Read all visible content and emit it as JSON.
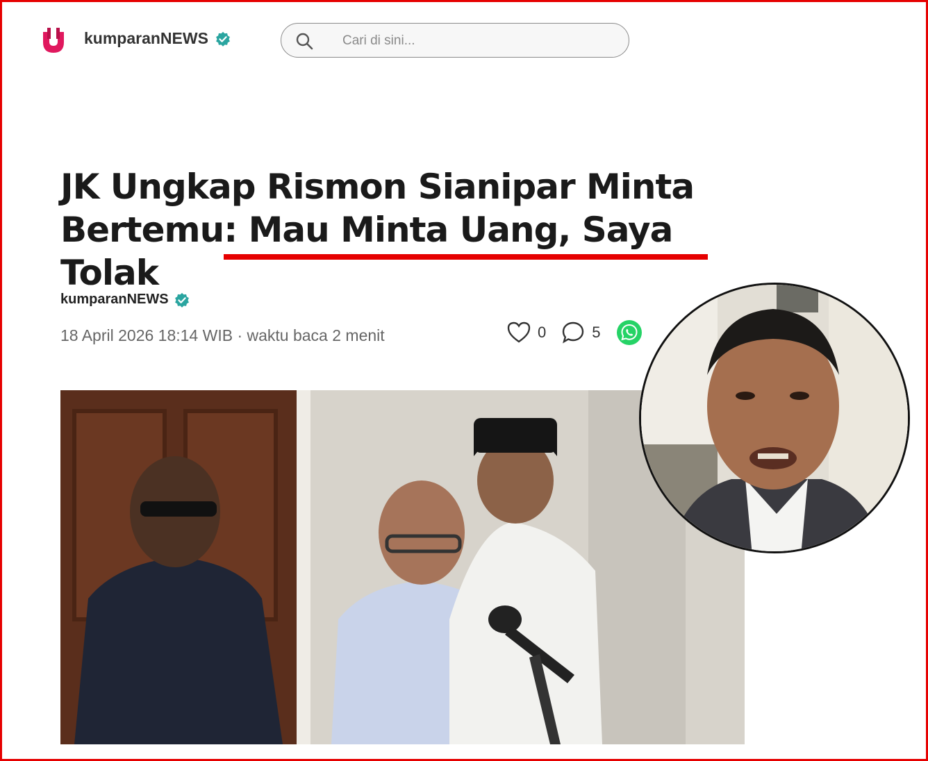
{
  "header": {
    "brand_name": "kumparanNEWS",
    "search_placeholder": "Cari di sini..."
  },
  "article": {
    "title": "JK Ungkap Rismon Sianipar Minta Bertemu: Mau Minta Uang, Saya Tolak",
    "author": "kumparanNEWS",
    "meta": "18 April 2026 18:14 WIB · waktu baca 2 menit",
    "likes": "0",
    "comments": "5"
  },
  "colors": {
    "accent": "#e60000",
    "verified": "#2aa5a0",
    "whatsapp": "#25d366"
  },
  "icons": [
    "logo-icon",
    "verified-icon",
    "search-icon",
    "heart-icon",
    "comment-icon",
    "whatsapp-icon"
  ]
}
